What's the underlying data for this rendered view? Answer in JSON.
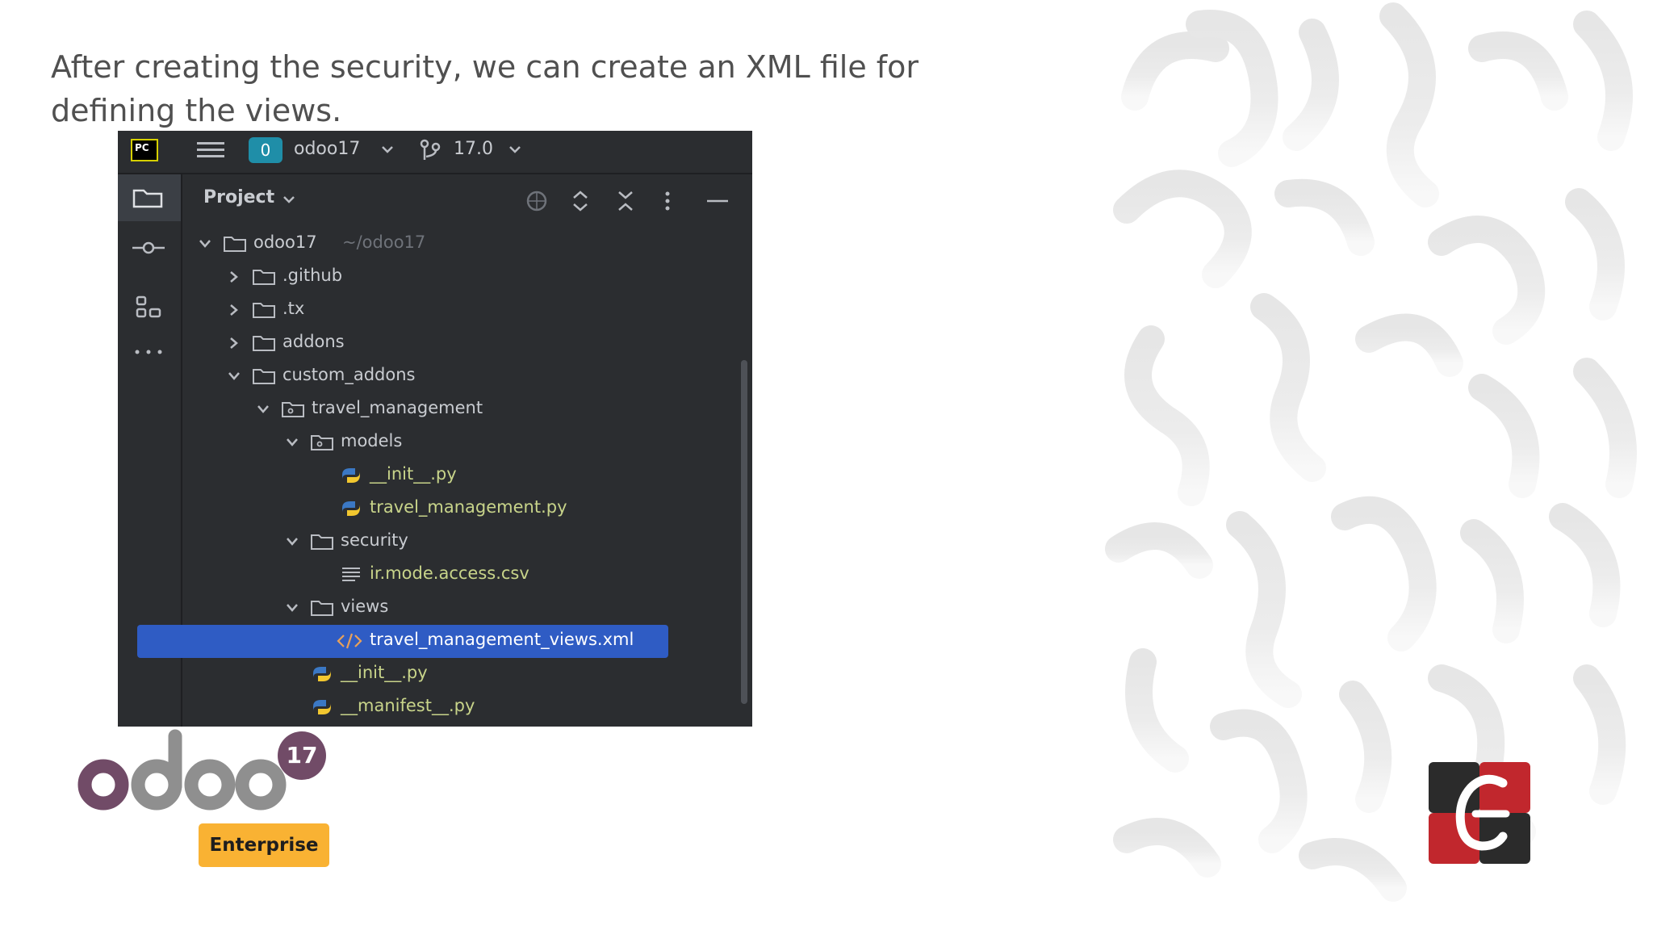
{
  "caption": "After creating the security, we can create an XML file for defining the views.",
  "ide": {
    "logo": "PC",
    "project_badge": "0",
    "project_name": "odoo17",
    "branch": "17.0",
    "panel_title": "Project",
    "tree": [
      {
        "label": "odoo17",
        "hint": "~/odoo17",
        "type": "folder",
        "state": "expanded"
      },
      {
        "label": ".github",
        "type": "folder",
        "state": "collapsed"
      },
      {
        "label": ".tx",
        "type": "folder",
        "state": "collapsed"
      },
      {
        "label": "addons",
        "type": "folder",
        "state": "collapsed"
      },
      {
        "label": "custom_addons",
        "type": "folder",
        "state": "expanded"
      },
      {
        "label": "travel_management",
        "type": "package",
        "state": "expanded"
      },
      {
        "label": "models",
        "type": "package",
        "state": "expanded"
      },
      {
        "label": "__init__.py",
        "type": "python"
      },
      {
        "label": "travel_management.py",
        "type": "python"
      },
      {
        "label": "security",
        "type": "folder",
        "state": "expanded"
      },
      {
        "label": "ir.mode.access.csv",
        "type": "csv"
      },
      {
        "label": "views",
        "type": "folder",
        "state": "expanded"
      },
      {
        "label": "travel_management_views.xml",
        "type": "xml",
        "selected": true
      },
      {
        "label": "__init__.py",
        "type": "python"
      },
      {
        "label": "__manifest__.py",
        "type": "python"
      }
    ]
  },
  "odoo": {
    "wordmark": "odoo",
    "version": "17",
    "edition": "Enterprise"
  },
  "colors": {
    "ide_bg": "#2b2d30",
    "selection": "#2f5cc4",
    "odoo_purple": "#714b67",
    "odoo_gray": "#8f8f8f",
    "enterprise_yellow": "#f9b233",
    "brand_red": "#c1272d"
  }
}
